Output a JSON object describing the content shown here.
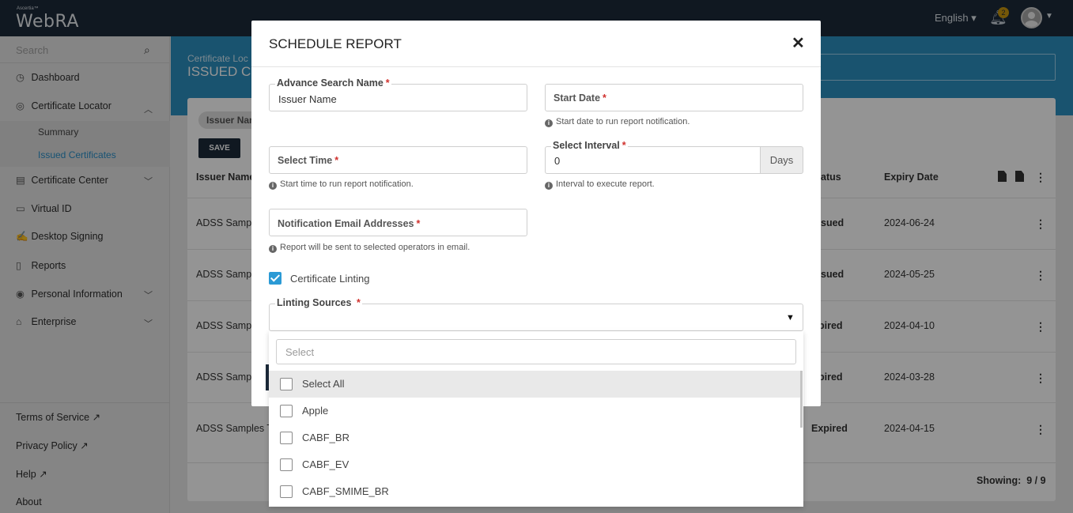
{
  "topbar": {
    "brand_small": "Ascertia™",
    "brand": "WebRA",
    "language": "English ▾",
    "notifications_count": "2"
  },
  "sidebar": {
    "search_placeholder": "Search",
    "items": [
      {
        "label": "Dashboard",
        "icon": "dashboard-icon"
      },
      {
        "label": "Certificate Locator",
        "icon": "compass-icon"
      },
      {
        "label": "Certificate Center",
        "icon": "certificate-icon"
      },
      {
        "label": "Virtual ID",
        "icon": "id-card-icon"
      },
      {
        "label": "Desktop Signing",
        "icon": "signing-icon"
      },
      {
        "label": "Reports",
        "icon": "report-icon"
      },
      {
        "label": "Personal Information",
        "icon": "user-circle-icon"
      },
      {
        "label": "Enterprise",
        "icon": "bank-icon"
      }
    ],
    "sub_items": [
      {
        "label": "Summary"
      },
      {
        "label": "Issued Certificates"
      }
    ],
    "footer": [
      {
        "label": "Terms of Service"
      },
      {
        "label": "Privacy Policy"
      },
      {
        "label": "Help"
      },
      {
        "label": "About"
      }
    ]
  },
  "page": {
    "breadcrumb": "Certificate Loc",
    "title": "ISSUED CE",
    "chip": "Issuer Nar",
    "save_label": "SAVE",
    "columns": {
      "issuer": "Issuer Name",
      "status": "atus",
      "expiry": "Expiry Date"
    },
    "rows": [
      {
        "issuer": "ADSS Sampl",
        "status": "sued",
        "expiry": "2024-06-24"
      },
      {
        "issuer": "ADSS Sampl",
        "status": "sued",
        "expiry": "2024-05-25"
      },
      {
        "issuer": "ADSS Sampl",
        "status": "pired",
        "expiry": "2024-04-10"
      },
      {
        "issuer": "ADSS Sampl",
        "status": "pired",
        "expiry": "2024-03-28"
      },
      {
        "issuer": "ADSS Samples T",
        "status": "Expired",
        "expiry": "2024-04-15"
      }
    ],
    "showing_label": "Showing:",
    "showing_value": "9 / 9"
  },
  "modal": {
    "title": "SCHEDULE REPORT",
    "close": "✕",
    "advance_search_name": {
      "label": "Advance Search Name",
      "value": "Issuer Name"
    },
    "start_date": {
      "label": "Start Date",
      "hint": "Start date to run report notification."
    },
    "select_time": {
      "label": "Select Time",
      "hint": "Start time to run report notification."
    },
    "select_interval": {
      "label": "Select Interval",
      "value": "0",
      "unit": "Days",
      "hint": "Interval to execute report."
    },
    "notification_email": {
      "label": "Notification Email Addresses",
      "hint": "Report will be sent to selected operators in email."
    },
    "certificate_linting": {
      "label": "Certificate Linting",
      "checked": true
    },
    "linting_sources": {
      "label": "Linting Sources",
      "search_placeholder": "Select",
      "options": [
        {
          "label": "Select All",
          "checked": false
        },
        {
          "label": "Apple",
          "checked": false
        },
        {
          "label": "CABF_BR",
          "checked": false
        },
        {
          "label": "CABF_EV",
          "checked": false
        },
        {
          "label": "CABF_SMIME_BR",
          "checked": false
        }
      ]
    },
    "required_mark": "*"
  },
  "colors": {
    "topbar": "#1c2a3a",
    "accent": "#2b8fbf",
    "required": "#d0312d",
    "checkbox": "#2b9ad5"
  }
}
